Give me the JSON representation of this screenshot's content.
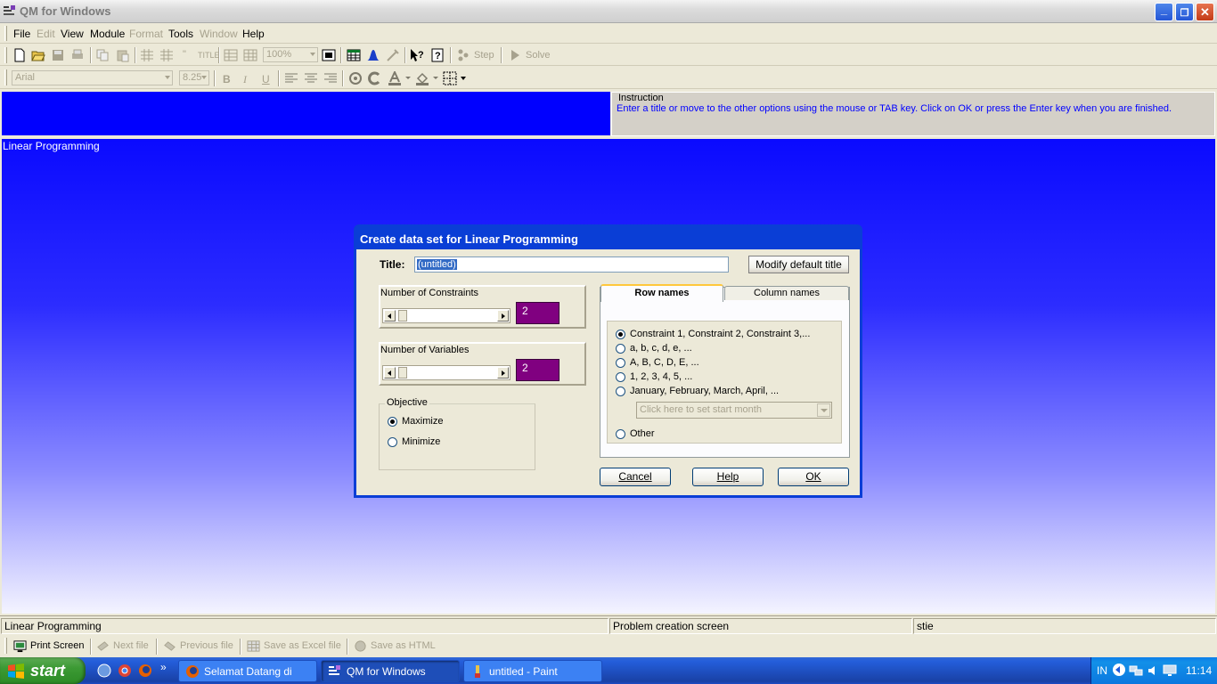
{
  "window": {
    "title": "QM for Windows",
    "controls": {
      "minimize": "_",
      "restore": "❐",
      "close": "✕"
    }
  },
  "menu": {
    "items": [
      {
        "label": "File",
        "enabled": true
      },
      {
        "label": "Edit",
        "enabled": false
      },
      {
        "label": "View",
        "enabled": true
      },
      {
        "label": "Module",
        "enabled": true
      },
      {
        "label": "Format",
        "enabled": false
      },
      {
        "label": "Tools",
        "enabled": true
      },
      {
        "label": "Window",
        "enabled": false
      },
      {
        "label": "Help",
        "enabled": true
      }
    ]
  },
  "toolbar": {
    "zoom": "100%",
    "step_label": "Step",
    "solve_label": "Solve",
    "font_name": "Arial",
    "font_size": "8.25",
    "bold": "B",
    "italic": "I",
    "underline": "U"
  },
  "instruction": {
    "label": "Instruction",
    "text": "Enter a title or move to the other options using the mouse or TAB key. Click on OK or press the Enter key when you are finished."
  },
  "main": {
    "module_label": "Linear Programming"
  },
  "dialog": {
    "title": "Create data set for Linear Programming",
    "title_label": "Title:",
    "title_value": "(untitled)",
    "modify_default_title": "Modify default title",
    "constraints_label": "Number of Constraints",
    "constraints_value": "2",
    "variables_label": "Number of Variables",
    "variables_value": "2",
    "objective": {
      "label": "Objective",
      "options": [
        "Maximize",
        "Minimize"
      ],
      "selected": "Maximize"
    },
    "tabs": [
      {
        "label": "Row names",
        "active": true
      },
      {
        "label": "Column names",
        "active": false
      }
    ],
    "row_name_options": [
      "Constraint 1, Constraint 2, Constraint 3,...",
      "a, b, c, d, e, ...",
      "A, B, C, D, E, ...",
      "1, 2, 3, 4, 5, ...",
      "January, February, March, April, ...",
      "Other"
    ],
    "selected_option": "Constraint 1, Constraint 2, Constraint 3,...",
    "start_month_placeholder": "Click here to set start month",
    "buttons": {
      "cancel": "Cancel",
      "help": "Help",
      "ok": "OK"
    }
  },
  "status": {
    "module": "Linear Programming",
    "screen": "Problem creation screen",
    "user": "stie"
  },
  "bottom_toolbar": {
    "print_screen": "Print Screen",
    "next_file": "Next file",
    "previous_file": "Previous file",
    "save_excel": "Save as Excel file",
    "save_html": "Save as HTML"
  },
  "taskbar": {
    "start": "start",
    "tasks": [
      {
        "label": "Selamat Datang di Fa...",
        "active": false
      },
      {
        "label": "QM for Windows",
        "active": true
      },
      {
        "label": "untitled - Paint",
        "active": false
      }
    ],
    "language": "IN",
    "clock": "11:14"
  },
  "colors": {
    "main_blue": "#0000ff",
    "value_purple": "#800080",
    "xp_dialog_blue": "#0a3ed6",
    "instruction_text": "#0000ff"
  }
}
